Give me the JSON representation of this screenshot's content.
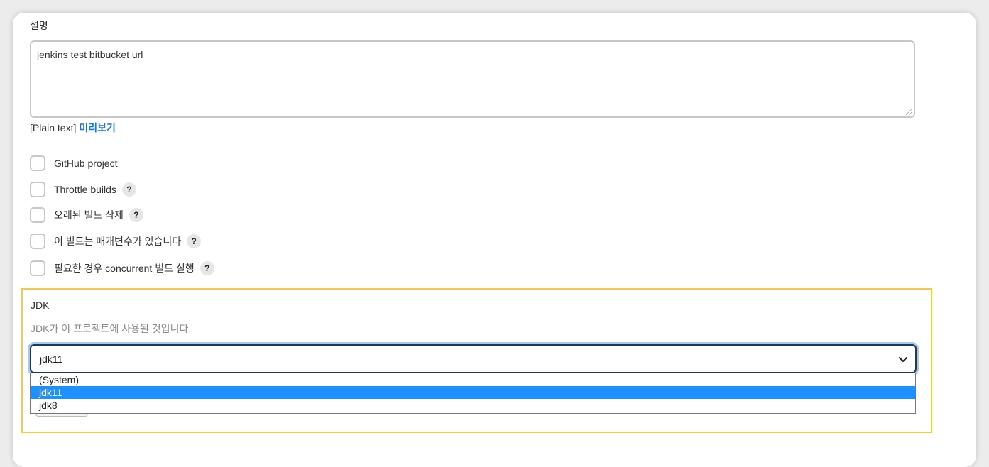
{
  "description": {
    "label": "설명",
    "value": "jenkins test bitbucket url",
    "format_note": "[Plain text]",
    "preview_link": "미리보기"
  },
  "options": [
    {
      "label": "GitHub project",
      "has_help": false
    },
    {
      "label": "Throttle builds",
      "has_help": true
    },
    {
      "label": "오래된 빌드 삭제",
      "has_help": true
    },
    {
      "label": "이 빌드는 매개변수가 있습니다",
      "has_help": true
    },
    {
      "label": "필요한 경우 concurrent 빌드 실행",
      "has_help": true
    }
  ],
  "help_glyph": "?",
  "jdk": {
    "title": "JDK",
    "description": "JDK가 이 프로젝트에 사용될 것입니다.",
    "selected": "jdk11",
    "options": [
      "(System)",
      "jdk11",
      "jdk8"
    ],
    "highlight_color": "#f7c948",
    "selection_color": "#1e90ff"
  },
  "colors": {
    "link": "#1a73e8"
  }
}
